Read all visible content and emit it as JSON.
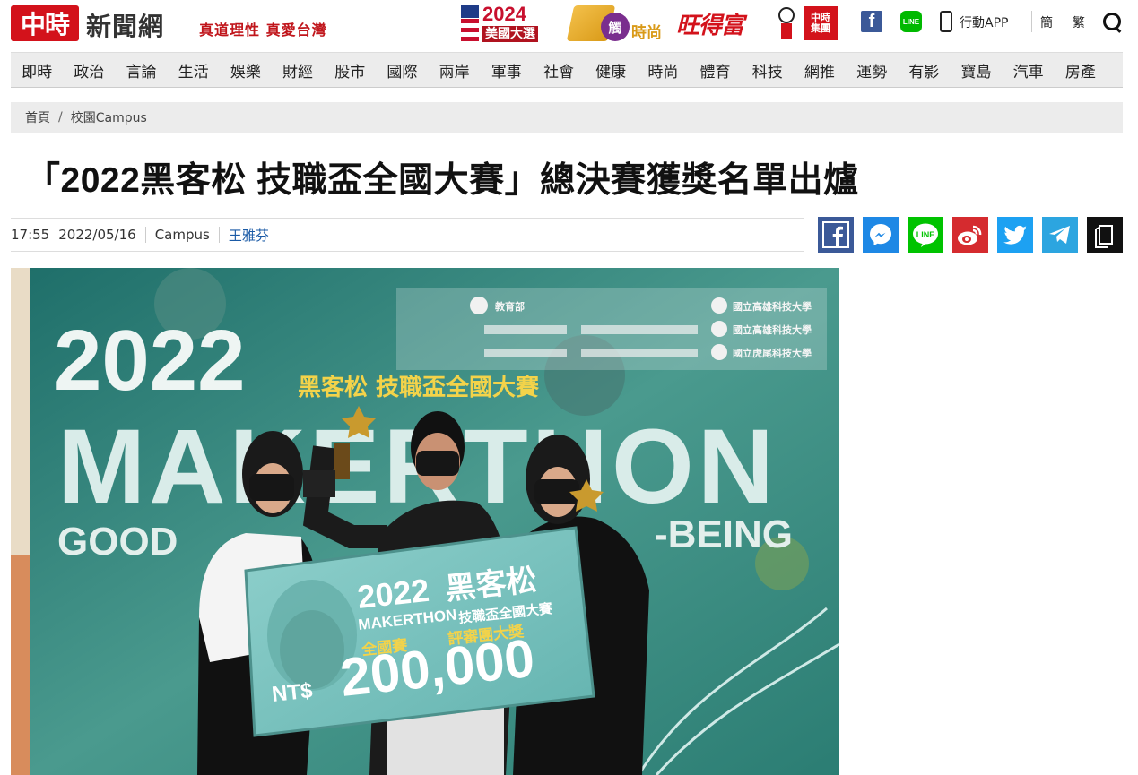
{
  "header": {
    "logo_mark": "中時",
    "logo_text": "新聞網",
    "slogan": "真道理性 真愛台灣",
    "election": {
      "year": "2024",
      "label": "美國大選"
    },
    "fashion": {
      "circle": "觸",
      "label": "時尚"
    },
    "wang": "旺得富",
    "group_badge": "中時\n集團",
    "app_label": "行動APP",
    "lang_simplified": "簡",
    "lang_traditional": "繁"
  },
  "nav": [
    "即時",
    "政治",
    "言論",
    "生活",
    "娛樂",
    "財經",
    "股市",
    "國際",
    "兩岸",
    "軍事",
    "社會",
    "健康",
    "時尚",
    "體育",
    "科技",
    "網推",
    "運勢",
    "有影",
    "寶島",
    "汽車",
    "房產"
  ],
  "breadcrumb": {
    "home": "首頁",
    "divider": "/",
    "section": "校園Campus"
  },
  "article": {
    "title": "「2022黑客松 技職盃全國大賽」總決賽獲獎名單出爐",
    "time": "17:55",
    "date": "2022/05/16",
    "category": "Campus",
    "author": "王雅芬"
  },
  "share": [
    {
      "name": "facebook",
      "color": "#3b5998"
    },
    {
      "name": "messenger",
      "color": "#1e88e5"
    },
    {
      "name": "line",
      "color": "#00c300"
    },
    {
      "name": "weibo",
      "color": "#d52b2f"
    },
    {
      "name": "twitter",
      "color": "#1da1f2"
    },
    {
      "name": "telegram",
      "color": "#2ca5e0"
    },
    {
      "name": "copy",
      "color": "#111111"
    }
  ],
  "photo": {
    "year": "2022",
    "event_cn": "黑客松 技職盃全國大賽",
    "event_en": "MAKERTHON",
    "sub_en_left": "GOOD",
    "sub_en_right": "-BEING",
    "sign_year": "2022",
    "sign_cn": "黑客松",
    "sign_cn2": "技職盃全國大賽",
    "sign_en": "MAKERTHON",
    "sign_round": "全國賽",
    "sign_award": "評審團大獎",
    "currency": "NT$",
    "prize": "200,000",
    "sponsors": [
      "國立高雄科技大學",
      "國立高雄科技大學",
      "國立虎尾科技大學"
    ]
  }
}
